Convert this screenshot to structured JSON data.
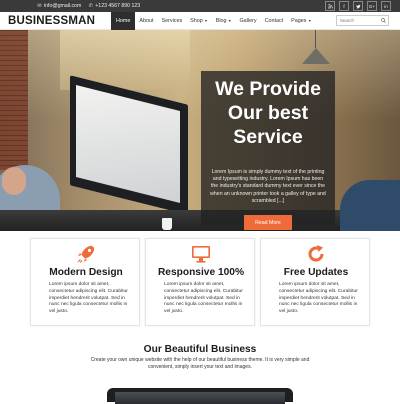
{
  "topbar": {
    "email": "info@gmail.com",
    "phone": "+123 4567 890 123",
    "social": [
      {
        "icon": "rss-icon",
        "glyph": "⌁"
      },
      {
        "icon": "facebook-icon",
        "glyph": "f"
      },
      {
        "icon": "twitter-icon",
        "glyph": "t"
      },
      {
        "icon": "google-plus-icon",
        "glyph": "G+"
      },
      {
        "icon": "linkedin-icon",
        "glyph": "in"
      }
    ]
  },
  "nav": {
    "logo": "BUSINESSMAN",
    "items": [
      {
        "label": "Home",
        "active": true,
        "dropdown": false
      },
      {
        "label": "About",
        "active": false,
        "dropdown": false
      },
      {
        "label": "Services",
        "active": false,
        "dropdown": false
      },
      {
        "label": "Shop",
        "active": false,
        "dropdown": true
      },
      {
        "label": "Blog",
        "active": false,
        "dropdown": true
      },
      {
        "label": "Gallery",
        "active": false,
        "dropdown": false
      },
      {
        "label": "Contact",
        "active": false,
        "dropdown": false
      },
      {
        "label": "Pages",
        "active": false,
        "dropdown": true
      }
    ],
    "search_placeholder": "Search"
  },
  "hero": {
    "heading_line1": "We Provide",
    "heading_line2": "Our best",
    "heading_line3": "Service",
    "text": "Lorem Ipsum is simply dummy text of the printing and typesetting industry. Lorem Ipsum has been the industry's standard dummy text ever since the when an unknown printer took a galley of type and scrambled [...]",
    "button": "Read More"
  },
  "features": [
    {
      "icon": "rocket-icon",
      "title": "Modern Design",
      "text": "Lorem ipsum dolor sit amet, consectetur adipiscing elit. Curabitur imperdiet hendrerit volutpat. Sed in nunc nec ligula consectetur mollis in vel justo."
    },
    {
      "icon": "monitor-icon",
      "title": "Responsive 100%",
      "text": "Lorem ipsum dolor sit amet, consectetur adipiscing elit. Curabitur imperdiet hendrerit volutpat. Sed in nunc nec ligula consectetur mollis in vel justo."
    },
    {
      "icon": "refresh-icon",
      "title": "Free Updates",
      "text": "Lorem ipsum dolor sit amet, consectetur adipiscing elit. Curabitur imperdiet hendrerit volutpat. Sed in nunc nec ligula consectetur mollis in vel justo."
    }
  ],
  "section": {
    "title": "Our Beautiful Business",
    "text": "Create your own unique website with the help of our beautiful business theme. It is very simple and convenient, simply insert your text and images."
  },
  "colors": {
    "accent": "#ef6b3a",
    "topbar": "#3a3a3a",
    "nav_active": "#2e2e2e"
  }
}
